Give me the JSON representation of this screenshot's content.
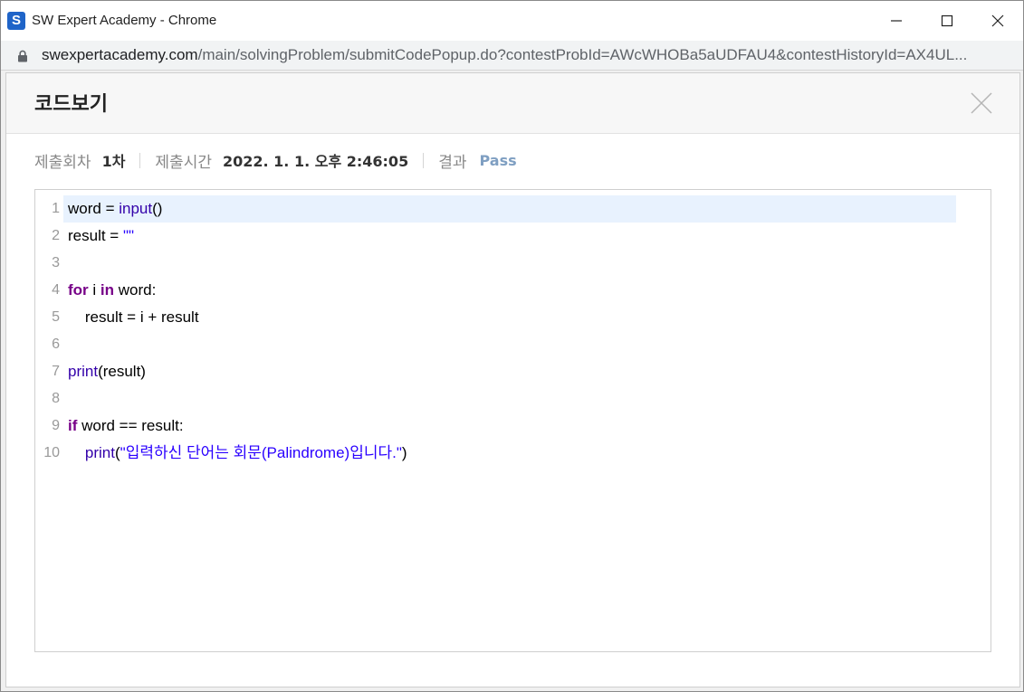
{
  "window": {
    "title": "SW Expert Academy - Chrome",
    "app_icon_letter": "S"
  },
  "address": {
    "host": "swexpertacademy.com",
    "path": "/main/solvingProblem/submitCodePopup.do?contestProbId=AWcWHOBa5aUDFAU4&contestHistoryId=AX4UL..."
  },
  "popup": {
    "title": "코드보기"
  },
  "meta": {
    "round_label": "제출회차",
    "round_value": "1차",
    "time_label": "제출시간",
    "time_value": "2022. 1. 1. 오후 2:46:05",
    "result_label": "결과",
    "result_value": "Pass"
  },
  "colors": {
    "keyword": "#770088",
    "builtin": "#3300aa",
    "string": "#2a00ff",
    "pass": "#7f9fc2",
    "active_line": "#e8f2fe"
  },
  "code": {
    "active_line": 1,
    "lines": [
      {
        "n": "1",
        "tokens": [
          {
            "t": "word = ",
            "c": ""
          },
          {
            "t": "input",
            "c": "bi"
          },
          {
            "t": "()",
            "c": ""
          }
        ]
      },
      {
        "n": "2",
        "tokens": [
          {
            "t": "result = ",
            "c": ""
          },
          {
            "t": "\"\"",
            "c": "str"
          }
        ]
      },
      {
        "n": "3",
        "tokens": []
      },
      {
        "n": "4",
        "tokens": [
          {
            "t": "for",
            "c": "kw"
          },
          {
            "t": " i ",
            "c": ""
          },
          {
            "t": "in",
            "c": "kw"
          },
          {
            "t": " word:",
            "c": ""
          }
        ]
      },
      {
        "n": "5",
        "tokens": [
          {
            "t": "    result = i + result",
            "c": ""
          }
        ]
      },
      {
        "n": "6",
        "tokens": []
      },
      {
        "n": "7",
        "tokens": [
          {
            "t": "print",
            "c": "bi"
          },
          {
            "t": "(result)",
            "c": ""
          }
        ]
      },
      {
        "n": "8",
        "tokens": []
      },
      {
        "n": "9",
        "tokens": [
          {
            "t": "if",
            "c": "kw"
          },
          {
            "t": " word == result:",
            "c": ""
          }
        ]
      },
      {
        "n": "10",
        "tokens": [
          {
            "t": "    ",
            "c": ""
          },
          {
            "t": "print",
            "c": "bi"
          },
          {
            "t": "(",
            "c": ""
          },
          {
            "t": "\"입력하신 단어는 회문(Palindrome)입니다.\"",
            "c": "str"
          },
          {
            "t": ")",
            "c": ""
          }
        ]
      }
    ]
  }
}
